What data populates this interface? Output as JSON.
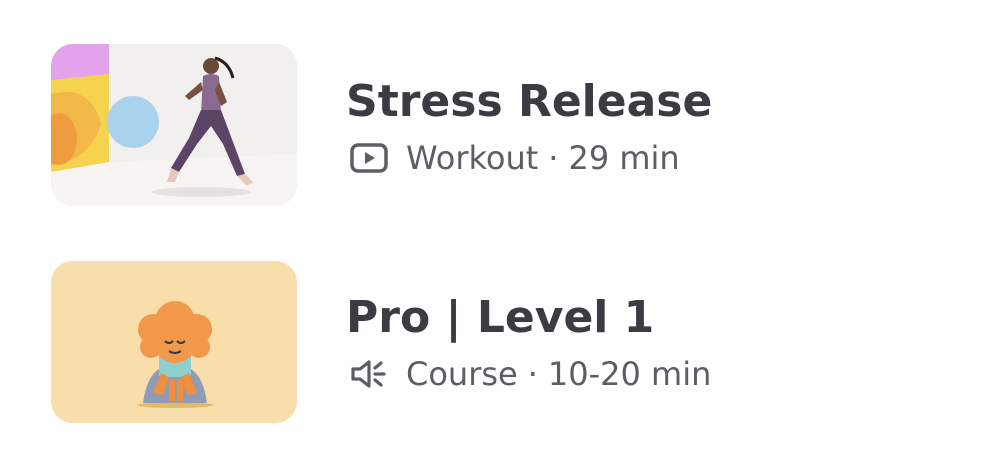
{
  "items": [
    {
      "title": "Stress Release",
      "type": "Workout",
      "separator": "·",
      "duration": "29 min",
      "type_icon": "video-play-icon",
      "thumbnail": "workout-thumbnail"
    },
    {
      "title": "Pro | Level 1",
      "type": "Course",
      "separator": "·",
      "duration": "10-20 min",
      "type_icon": "audio-speaker-icon",
      "thumbnail": "meditation-character-thumbnail"
    }
  ],
  "colors": {
    "title": "#3c3b42",
    "meta": "#5f5d64",
    "course_thumb_bg": "#f8deab",
    "workout_thumb_bg": "#f1f0ee"
  }
}
